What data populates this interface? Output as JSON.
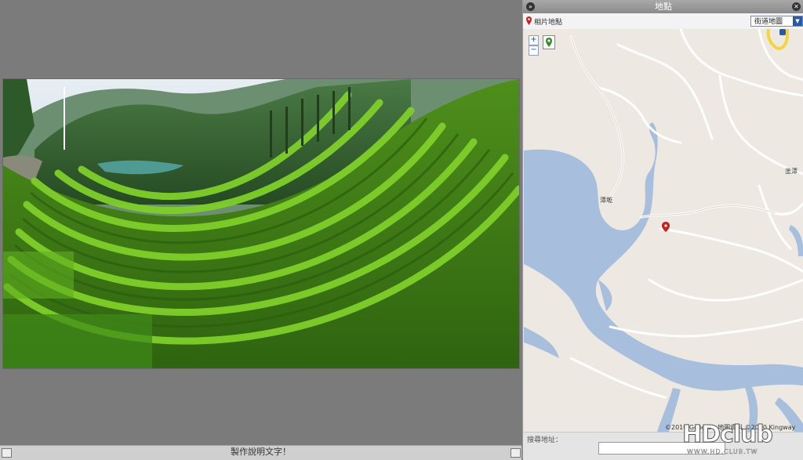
{
  "caption": {
    "text": "製作說明文字！"
  },
  "map_panel": {
    "title": "地點",
    "toolbar_label": "相片地點",
    "map_type_selected": "街道地圖",
    "place_label_1": "潭墘",
    "place_label_2": "塗潭",
    "copyright": "©2010 Google - 地圖資料 ©2010 Kingway",
    "search_label": "搜尋地址："
  },
  "watermark": {
    "main": "HDclub",
    "url": "WWW.HD.CLUB.TW"
  },
  "colors": {
    "water": "#a7bfdc",
    "land": "#ede9e2",
    "road": "#ffffff",
    "highway": "#f4d53f",
    "pin": "#c8211e"
  }
}
